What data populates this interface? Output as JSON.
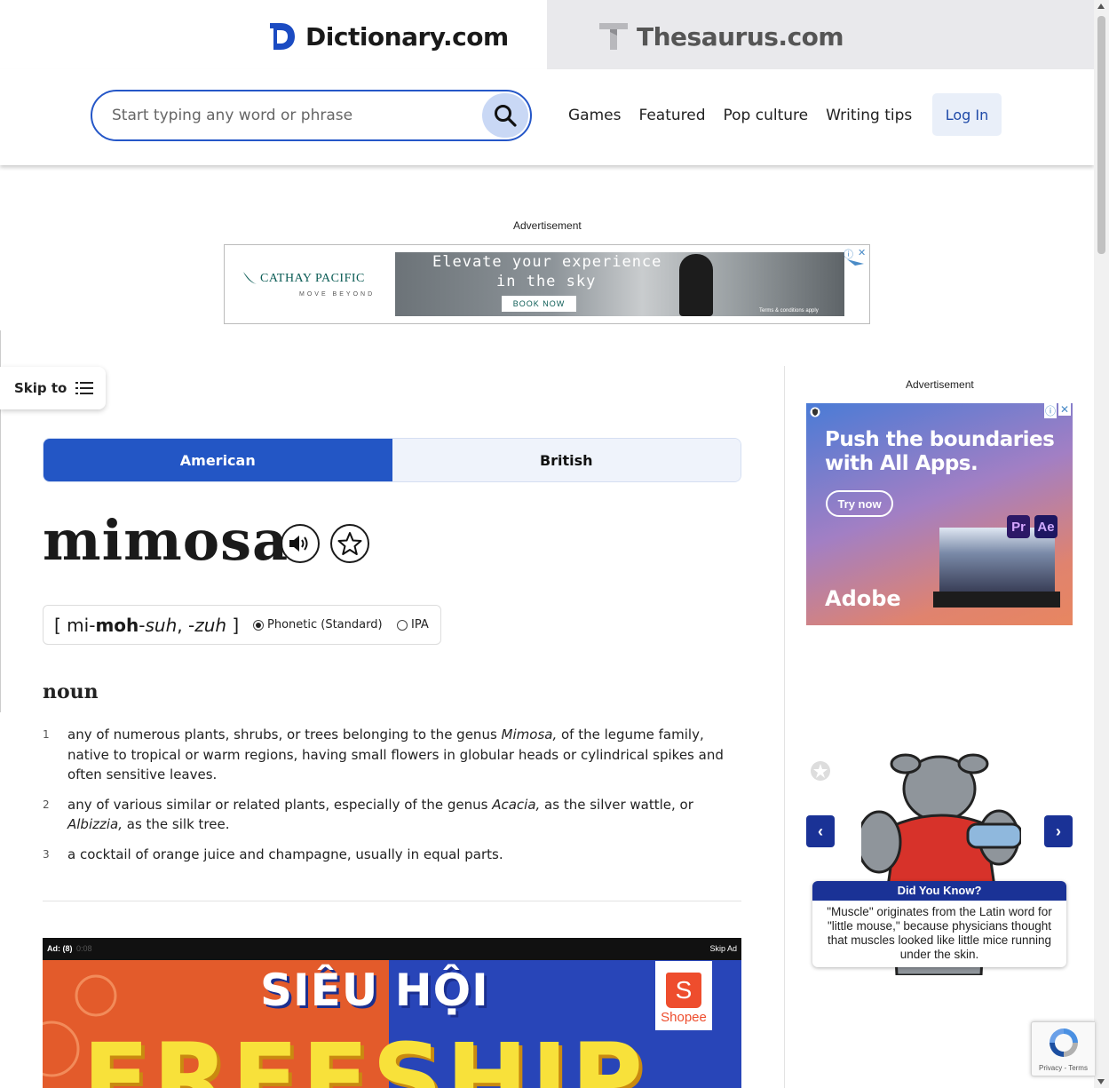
{
  "tabs": {
    "dictionary": "Dictionary.com",
    "thesaurus": "Thesaurus.com"
  },
  "search": {
    "placeholder": "Start typing any word or phrase"
  },
  "nav": {
    "items": [
      "Games",
      "Featured",
      "Pop culture",
      "Writing tips"
    ],
    "login": "Log In"
  },
  "ads": {
    "label": "Advertisement",
    "banner": {
      "brand": "CATHAY PACIFIC",
      "tagline": "MOVE BEYOND",
      "headline_1": "Elevate your experience",
      "headline_2": "in the sky",
      "cta": "BOOK NOW",
      "fineprint": "Terms & conditions apply"
    },
    "sidebar": {
      "headline_1": "Push the boundaries",
      "headline_2": "with All Apps.",
      "cta": "Try now",
      "brand": "Adobe",
      "badge_1": "Pr",
      "badge_2": "Ae"
    },
    "video": {
      "ad_count": "Ad: (8)",
      "timer": "0:08",
      "skip": "Skip Ad",
      "title": "SIÊU HỘI",
      "big_text": "FREESHIP",
      "shopee": "Shopee"
    }
  },
  "skip_to": "Skip to",
  "dialect": {
    "american": "American",
    "british": "British",
    "selected": "American"
  },
  "entry": {
    "headword": "mimosa",
    "pron_open": "[ ",
    "pron_1": "mi-",
    "pron_2": "moh",
    "pron_3": "-",
    "pron_4": "suh",
    "pron_5": ", -",
    "pron_6": "zuh",
    "pron_close": " ]",
    "pron_mode_1": "Phonetic (Standard)",
    "pron_mode_2": "IPA",
    "part_of_speech": "noun",
    "definitions": [
      {
        "num": "1",
        "a": "any of numerous plants, shrubs, or trees belonging to the genus ",
        "b": "Mimosa,",
        "c": " of the legume family, native to tropical or warm regions, having small flowers in globular heads or cylindrical spikes and often sensitive leaves."
      },
      {
        "num": "2",
        "a": "any of various similar or related plants, especially of the genus ",
        "b": "Acacia,",
        "c": " as the silver wattle, or ",
        "d": "Albizzia,",
        "e": " as the silk tree."
      },
      {
        "num": "3",
        "a": "a cocktail of orange juice and champagne, usually in equal parts."
      }
    ]
  },
  "did_you_know": {
    "title": "Did You Know?",
    "text": "\"Muscle\" originates from the Latin word for \"little mouse,\" because physicians thought that muscles looked like little mice running under the skin."
  },
  "recaptcha": {
    "text": "Privacy - Terms"
  },
  "colors": {
    "accent": "#2356c5",
    "nav_blue": "#1a3296"
  }
}
